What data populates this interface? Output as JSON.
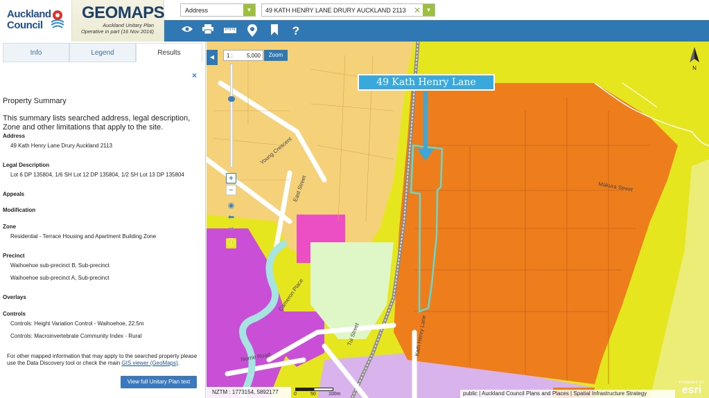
{
  "header": {
    "council_line1": "Auckland",
    "council_line2": "Council",
    "brand": "GEOMAPS",
    "brand_sub1": "Auckland Unitary Plan",
    "brand_sub2": "Operative in part (16 Nov 2016)"
  },
  "search": {
    "type_value": "Address",
    "query_value": "49 KATH HENRY LANE DRURY AUCKLAND 2113"
  },
  "toolbar": {
    "icons": [
      "eye-icon",
      "print-icon",
      "ruler-icon",
      "pin-icon",
      "bookmark-icon",
      "help-icon"
    ],
    "help_label": "?"
  },
  "panel": {
    "tabs": [
      {
        "label": "Info"
      },
      {
        "label": "Legend"
      },
      {
        "label": "Results"
      }
    ],
    "active_tab": "Results",
    "close_label": "×",
    "summary_title": "Property Summary",
    "summary_desc": "This summary lists searched address, legal description, Zone and other limitations that apply to the site.",
    "sections": {
      "address_h": "Address",
      "address_v": "49 Kath Henry Lane Drury Auckland 2113",
      "legal_h": "Legal Description",
      "legal_v": "Lot 6 DP 135804, 1/6 SH Lot 12 DP 135804, 1/2 SH Lot 13 DP 135804",
      "appeals_h": "Appeals",
      "modification_h": "Modification",
      "zone_h": "Zone",
      "zone_v": "Residential - Terrace Housing and Apartment Building Zone",
      "precinct_h": "Precinct",
      "precinct_v1": "Waihoehoe sub-precinct B, Sub-precinct",
      "precinct_v2": "Waihoehoe sub-precinct A, Sub-precinct",
      "overlays_h": "Overlays",
      "controls_h": "Controls",
      "controls_v1": "Controls: Height Variation Control - Waihoehoe, 22.5m",
      "controls_v2": "Controls: Macroinvertebrate Community Index - Rural"
    },
    "footer_text": "For other mapped information that may apply to the searched property please use the Data Discovery tool or check the main",
    "footer_link": "GIS viewer (GeoMaps)",
    "footer_end": ".",
    "view_button": "View full Unitary Plan text"
  },
  "map": {
    "scale_prefix": "1 :",
    "scale_value": "5,000",
    "zoom_label": "Zoom",
    "north_label": "N",
    "callout": "49 Kath Henry Lane",
    "coords": "NZTM : 1773154, 5892177",
    "scalebar_labels": [
      "0",
      "50",
      "100m"
    ],
    "attribution": "public | Auckland Council Plans and Places | Spatial Infrastructure Strategy",
    "esri_powered": "POWERED BY",
    "esri_brand": "esri",
    "streets": {
      "young_crescent": "Young Crescent",
      "east_street": "East Street",
      "cameron_place": "Cameron Place",
      "norrie_road": "Norrie Road",
      "kath_henry_lane": "Kath Henry Lane",
      "makura_street": "Makura Street",
      "tui_street": "Tui Street",
      "waihoehoe": "Waihoehoe Road"
    },
    "colors": {
      "orange_zone": "#ee7d1c",
      "yellow_zone": "#e6e61e",
      "light_yellow": "#f5d27a",
      "magenta": "#c84fd6",
      "pink": "#ec4fc4",
      "light_green": "#dff7c7",
      "river": "#a5e4e0",
      "highlight": "#5fdad4"
    }
  }
}
